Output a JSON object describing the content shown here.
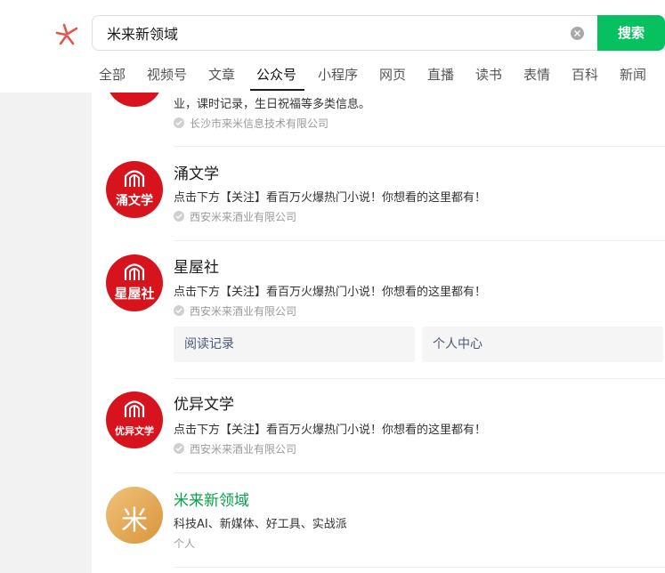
{
  "header": {
    "search_value": "米来新领域",
    "search_button": "搜索",
    "brand_color": "#07c160"
  },
  "tabs": [
    {
      "label": "全部"
    },
    {
      "label": "视频号"
    },
    {
      "label": "文章"
    },
    {
      "label": "公众号",
      "active": true
    },
    {
      "label": "小程序"
    },
    {
      "label": "网页"
    },
    {
      "label": "直播"
    },
    {
      "label": "读书"
    },
    {
      "label": "表情"
    },
    {
      "label": "百科"
    },
    {
      "label": "新闻"
    }
  ],
  "results": [
    {
      "desc": "业，课时记录，生日祝福等多类信息。",
      "meta": "长沙市来米信息技术有限公司"
    },
    {
      "name": "涌文学",
      "avatar_text": "涌文学",
      "desc": "点击下方【关注】看百万火爆热门小说！你想看的这里都有！",
      "meta": "西安米来酒业有限公司"
    },
    {
      "name": "星屋社",
      "avatar_text": "星屋社",
      "desc": "点击下方【关注】看百万火爆热门小说！你想看的这里都有！",
      "meta": "西安米来酒业有限公司",
      "menus": [
        "阅读记录",
        "个人中心"
      ]
    },
    {
      "name": "优异文学",
      "avatar_text": "优异文学",
      "desc": "点击下方【关注】看百万火爆热门小说！你想看的这里都有！",
      "meta": "西安米来酒业有限公司"
    },
    {
      "name": "米来新领域",
      "avatar_text": "米",
      "desc": "科技AI、新媒体、好工具、实战派",
      "meta": "个人"
    }
  ]
}
